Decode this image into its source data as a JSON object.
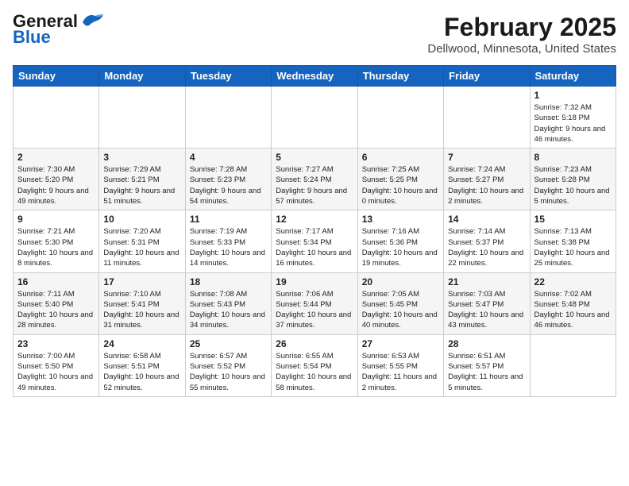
{
  "header": {
    "logo_general": "General",
    "logo_blue": "Blue",
    "main_title": "February 2025",
    "subtitle": "Dellwood, Minnesota, United States"
  },
  "weekdays": [
    "Sunday",
    "Monday",
    "Tuesday",
    "Wednesday",
    "Thursday",
    "Friday",
    "Saturday"
  ],
  "weeks": [
    [
      {
        "day": "",
        "info": ""
      },
      {
        "day": "",
        "info": ""
      },
      {
        "day": "",
        "info": ""
      },
      {
        "day": "",
        "info": ""
      },
      {
        "day": "",
        "info": ""
      },
      {
        "day": "",
        "info": ""
      },
      {
        "day": "1",
        "info": "Sunrise: 7:32 AM\nSunset: 5:18 PM\nDaylight: 9 hours and 46 minutes."
      }
    ],
    [
      {
        "day": "2",
        "info": "Sunrise: 7:30 AM\nSunset: 5:20 PM\nDaylight: 9 hours and 49 minutes."
      },
      {
        "day": "3",
        "info": "Sunrise: 7:29 AM\nSunset: 5:21 PM\nDaylight: 9 hours and 51 minutes."
      },
      {
        "day": "4",
        "info": "Sunrise: 7:28 AM\nSunset: 5:23 PM\nDaylight: 9 hours and 54 minutes."
      },
      {
        "day": "5",
        "info": "Sunrise: 7:27 AM\nSunset: 5:24 PM\nDaylight: 9 hours and 57 minutes."
      },
      {
        "day": "6",
        "info": "Sunrise: 7:25 AM\nSunset: 5:25 PM\nDaylight: 10 hours and 0 minutes."
      },
      {
        "day": "7",
        "info": "Sunrise: 7:24 AM\nSunset: 5:27 PM\nDaylight: 10 hours and 2 minutes."
      },
      {
        "day": "8",
        "info": "Sunrise: 7:23 AM\nSunset: 5:28 PM\nDaylight: 10 hours and 5 minutes."
      }
    ],
    [
      {
        "day": "9",
        "info": "Sunrise: 7:21 AM\nSunset: 5:30 PM\nDaylight: 10 hours and 8 minutes."
      },
      {
        "day": "10",
        "info": "Sunrise: 7:20 AM\nSunset: 5:31 PM\nDaylight: 10 hours and 11 minutes."
      },
      {
        "day": "11",
        "info": "Sunrise: 7:19 AM\nSunset: 5:33 PM\nDaylight: 10 hours and 14 minutes."
      },
      {
        "day": "12",
        "info": "Sunrise: 7:17 AM\nSunset: 5:34 PM\nDaylight: 10 hours and 16 minutes."
      },
      {
        "day": "13",
        "info": "Sunrise: 7:16 AM\nSunset: 5:36 PM\nDaylight: 10 hours and 19 minutes."
      },
      {
        "day": "14",
        "info": "Sunrise: 7:14 AM\nSunset: 5:37 PM\nDaylight: 10 hours and 22 minutes."
      },
      {
        "day": "15",
        "info": "Sunrise: 7:13 AM\nSunset: 5:38 PM\nDaylight: 10 hours and 25 minutes."
      }
    ],
    [
      {
        "day": "16",
        "info": "Sunrise: 7:11 AM\nSunset: 5:40 PM\nDaylight: 10 hours and 28 minutes."
      },
      {
        "day": "17",
        "info": "Sunrise: 7:10 AM\nSunset: 5:41 PM\nDaylight: 10 hours and 31 minutes."
      },
      {
        "day": "18",
        "info": "Sunrise: 7:08 AM\nSunset: 5:43 PM\nDaylight: 10 hours and 34 minutes."
      },
      {
        "day": "19",
        "info": "Sunrise: 7:06 AM\nSunset: 5:44 PM\nDaylight: 10 hours and 37 minutes."
      },
      {
        "day": "20",
        "info": "Sunrise: 7:05 AM\nSunset: 5:45 PM\nDaylight: 10 hours and 40 minutes."
      },
      {
        "day": "21",
        "info": "Sunrise: 7:03 AM\nSunset: 5:47 PM\nDaylight: 10 hours and 43 minutes."
      },
      {
        "day": "22",
        "info": "Sunrise: 7:02 AM\nSunset: 5:48 PM\nDaylight: 10 hours and 46 minutes."
      }
    ],
    [
      {
        "day": "23",
        "info": "Sunrise: 7:00 AM\nSunset: 5:50 PM\nDaylight: 10 hours and 49 minutes."
      },
      {
        "day": "24",
        "info": "Sunrise: 6:58 AM\nSunset: 5:51 PM\nDaylight: 10 hours and 52 minutes."
      },
      {
        "day": "25",
        "info": "Sunrise: 6:57 AM\nSunset: 5:52 PM\nDaylight: 10 hours and 55 minutes."
      },
      {
        "day": "26",
        "info": "Sunrise: 6:55 AM\nSunset: 5:54 PM\nDaylight: 10 hours and 58 minutes."
      },
      {
        "day": "27",
        "info": "Sunrise: 6:53 AM\nSunset: 5:55 PM\nDaylight: 11 hours and 2 minutes."
      },
      {
        "day": "28",
        "info": "Sunrise: 6:51 AM\nSunset: 5:57 PM\nDaylight: 11 hours and 5 minutes."
      },
      {
        "day": "",
        "info": ""
      }
    ]
  ]
}
